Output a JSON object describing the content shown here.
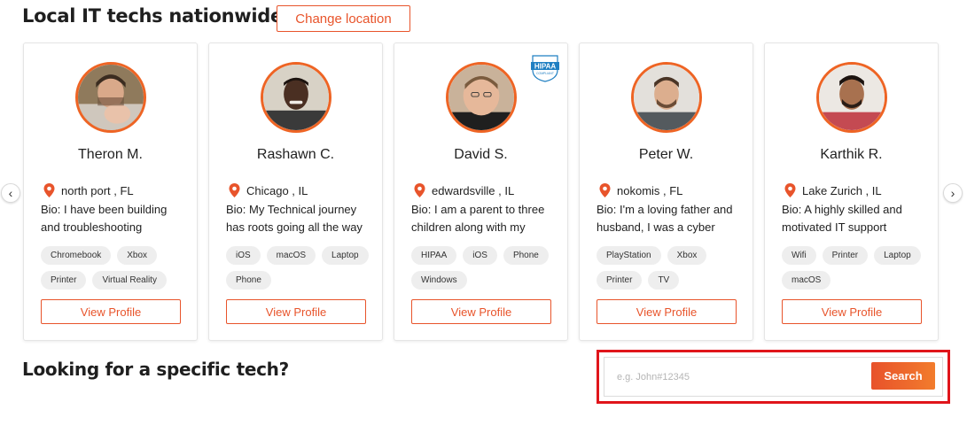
{
  "header": {
    "title": "Local IT techs nationwide",
    "change_location_label": "Change location"
  },
  "carousel": {
    "prev_label": "‹",
    "next_label": "›"
  },
  "techs": [
    {
      "name": "Theron M.",
      "location": "north port , FL",
      "bio": "Bio: I have been building and troubleshooting",
      "tags": [
        "Chromebook",
        "Xbox",
        "Printer",
        "Virtual Reality"
      ],
      "hipaa": false,
      "view_label": "View Profile"
    },
    {
      "name": "Rashawn C.",
      "location": "Chicago , IL",
      "bio": "Bio: My Technical journey has roots going all the way",
      "tags": [
        "iOS",
        "macOS",
        "Laptop",
        "Phone"
      ],
      "hipaa": false,
      "view_label": "View Profile"
    },
    {
      "name": "David S.",
      "location": "edwardsville , IL",
      "bio": "Bio: I am a parent to three children along with my",
      "tags": [
        "HIPAA",
        "iOS",
        "Phone",
        "Windows"
      ],
      "hipaa": true,
      "hipaa_badge_text": "HIPAA",
      "hipaa_badge_sub": "COMPLIANT",
      "view_label": "View Profile"
    },
    {
      "name": "Peter W.",
      "location": "nokomis , FL",
      "bio": "Bio: I'm a loving father and husband, I was a cyber",
      "tags": [
        "PlayStation",
        "Xbox",
        "Printer",
        "TV"
      ],
      "hipaa": false,
      "view_label": "View Profile"
    },
    {
      "name": "Karthik R.",
      "location": "Lake Zurich , IL",
      "bio": "Bio: A highly skilled and motivated IT support",
      "tags": [
        "Wifi",
        "Printer",
        "Laptop",
        "macOS"
      ],
      "hipaa": false,
      "view_label": "View Profile"
    }
  ],
  "specific": {
    "title": "Looking for a specific tech?",
    "search_placeholder": "e.g. John#12345",
    "search_value": "",
    "search_label": "Search"
  },
  "colors": {
    "accent": "#e8542b",
    "avatar_ring": "#ee6424",
    "highlight_outline": "#e0151b",
    "hipaa_blue": "#1f7fc2"
  },
  "icons": {
    "pin": "location-pin-icon",
    "prev": "chevron-left-icon",
    "next": "chevron-right-icon",
    "hipaa": "hipaa-shield-icon"
  }
}
